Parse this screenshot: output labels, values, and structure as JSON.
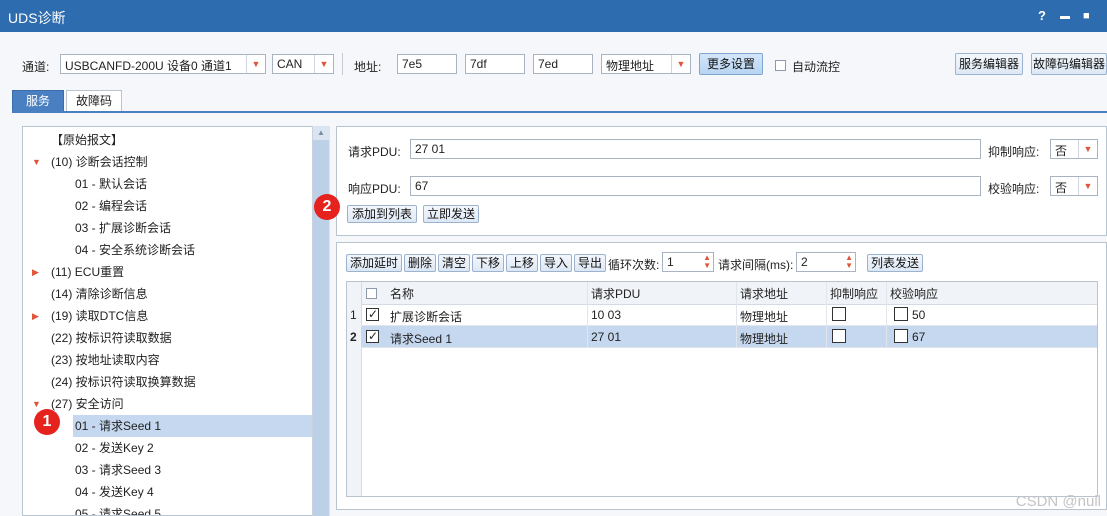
{
  "window": {
    "title": "UDS诊断",
    "help": "?",
    "minimize": "▬",
    "maximize": "■"
  },
  "toolbar": {
    "channel_label": "通道:",
    "channel_value": "USBCANFD-200U 设备0 通道1",
    "protocol_value": "CAN",
    "address_label": "地址:",
    "addr1": "7e5",
    "addr2": "7df",
    "addr3": "7ed",
    "addr_type": "物理地址",
    "more_settings": "更多设置",
    "auto_flow": "自动流控",
    "service_editor": "服务编辑器",
    "dtc_editor": "故障码编辑器"
  },
  "tabs": [
    {
      "label": "服务",
      "active": true
    },
    {
      "label": "故障码",
      "active": false
    }
  ],
  "tree": [
    {
      "label": "【原始报文】",
      "level": 0,
      "expander": ""
    },
    {
      "label": "(10) 诊断会话控制",
      "level": 0,
      "expander": "▼"
    },
    {
      "label": "01 - 默认会话",
      "level": 1
    },
    {
      "label": "02 - 编程会话",
      "level": 1
    },
    {
      "label": "03 - 扩展诊断会话",
      "level": 1
    },
    {
      "label": "04 - 安全系统诊断会话",
      "level": 1
    },
    {
      "label": "(11) ECU重置",
      "level": 0,
      "expander": "▶"
    },
    {
      "label": "(14) 清除诊断信息",
      "level": 0,
      "expander": ""
    },
    {
      "label": "(19) 读取DTC信息",
      "level": 0,
      "expander": "▶"
    },
    {
      "label": "(22) 按标识符读取数据",
      "level": 0,
      "expander": ""
    },
    {
      "label": "(23) 按地址读取内容",
      "level": 0,
      "expander": ""
    },
    {
      "label": "(24) 按标识符读取换算数据",
      "level": 0,
      "expander": ""
    },
    {
      "label": "(27) 安全访问",
      "level": 0,
      "expander": "▼"
    },
    {
      "label": "01 - 请求Seed 1",
      "level": 1,
      "selected": true
    },
    {
      "label": "02 - 发送Key 2",
      "level": 1
    },
    {
      "label": "03 - 请求Seed 3",
      "level": 1
    },
    {
      "label": "04 - 发送Key 4",
      "level": 1
    },
    {
      "label": "05 - 请求Seed 5",
      "level": 1
    }
  ],
  "pdu": {
    "req_label": "请求PDU:",
    "req_value": "27 01",
    "resp_label": "响应PDU:",
    "resp_value": "67",
    "suppress_label": "抑制响应:",
    "suppress_value": "否",
    "verify_label": "校验响应:",
    "verify_value": "否",
    "add_to_list": "添加到列表",
    "send_now": "立即发送"
  },
  "list_toolbar": {
    "buttons": [
      "添加延时",
      "删除",
      "清空",
      "下移",
      "上移",
      "导入",
      "导出"
    ],
    "loop_label": "循环次数:",
    "loop_value": "1",
    "interval_label": "请求间隔(ms):",
    "interval_value": "2",
    "list_send": "列表发送"
  },
  "table": {
    "headers": [
      "名称",
      "请求PDU",
      "请求地址",
      "抑制响应",
      "校验响应"
    ],
    "rows": [
      {
        "idx": "1",
        "checked": true,
        "name": "扩展诊断会话",
        "pdu": "10 03",
        "addr": "物理地址",
        "suppress": false,
        "verify_value": "50",
        "selected": false
      },
      {
        "idx": "2",
        "checked": true,
        "name": "请求Seed 1",
        "pdu": "27 01",
        "addr": "物理地址",
        "suppress": false,
        "verify_value": "67",
        "selected": true
      }
    ]
  },
  "annotations": {
    "badge1": "1",
    "badge2": "2"
  },
  "watermark": "CSDN @null",
  "colors": {
    "titlebar": "#2d6cae",
    "selection": "#c5d8f0",
    "badge": "#e5221d",
    "arrow": "#e0553a"
  }
}
